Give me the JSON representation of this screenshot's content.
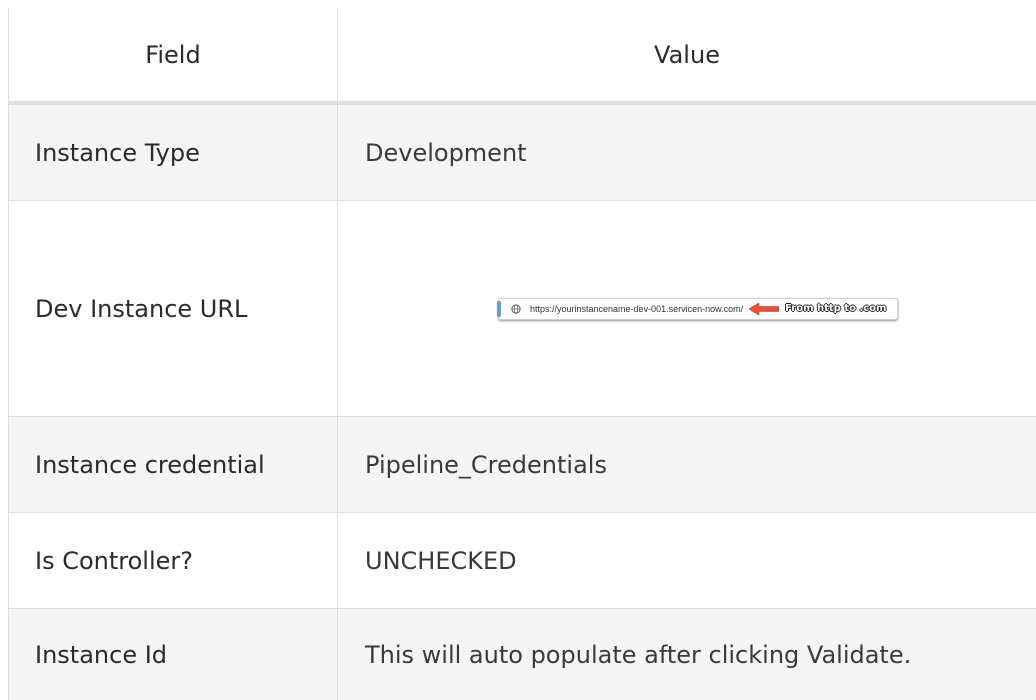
{
  "table": {
    "headers": {
      "field": "Field",
      "value": "Value"
    },
    "rows": [
      {
        "field": "Instance Type",
        "value": "Development"
      },
      {
        "field": "Dev Instance URL",
        "value": ""
      },
      {
        "field": "Instance credential",
        "value": "Pipeline_Credentials"
      },
      {
        "field": "Is Controller?",
        "value": "UNCHECKED"
      },
      {
        "field": "Instance Id",
        "value": "This will auto populate after clicking Validate."
      }
    ]
  },
  "url_image": {
    "url": "https://yourinstancename-dev-001.servicen-now.com/",
    "note": "From http to .com",
    "arrow_color": "#e8503a",
    "icons": [
      "globe-icon",
      "left-arrow-icon"
    ]
  }
}
